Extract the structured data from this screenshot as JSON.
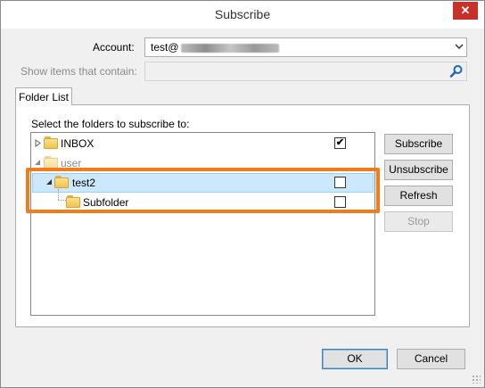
{
  "window": {
    "title": "Subscribe",
    "close_glyph": "✕"
  },
  "form": {
    "account_label": "Account:",
    "account_value": "test@",
    "search_label": "Show items that contain:",
    "search_value": "",
    "search_placeholder": ""
  },
  "tabs": [
    {
      "label": "Folder List",
      "active": true
    }
  ],
  "tree": {
    "instruction": "Select the folders to subscribe to:",
    "items": [
      {
        "label": "INBOX",
        "checked": true,
        "expander": "collapsed"
      },
      {
        "label": "user",
        "checked": null,
        "expander": "expanded"
      },
      {
        "label": "test2",
        "checked": false,
        "expander": "expanded",
        "selected": true
      },
      {
        "label": "Subfolder",
        "checked": false,
        "expander": "none"
      }
    ],
    "check_glyph": "✔"
  },
  "side_buttons": {
    "subscribe": "Subscribe",
    "unsubscribe": "Unsubscribe",
    "refresh": "Refresh",
    "stop": "Stop"
  },
  "footer_buttons": {
    "ok": "OK",
    "cancel": "Cancel"
  },
  "colors": {
    "highlight": "#f07d1a",
    "selection": "#cce8ff",
    "close": "#c7312a"
  },
  "icons": [
    "close-icon",
    "chevron-down-icon",
    "search-icon",
    "folder-icon",
    "expand-arrow-icon",
    "collapse-arrow-icon",
    "resize-grip-icon"
  ]
}
